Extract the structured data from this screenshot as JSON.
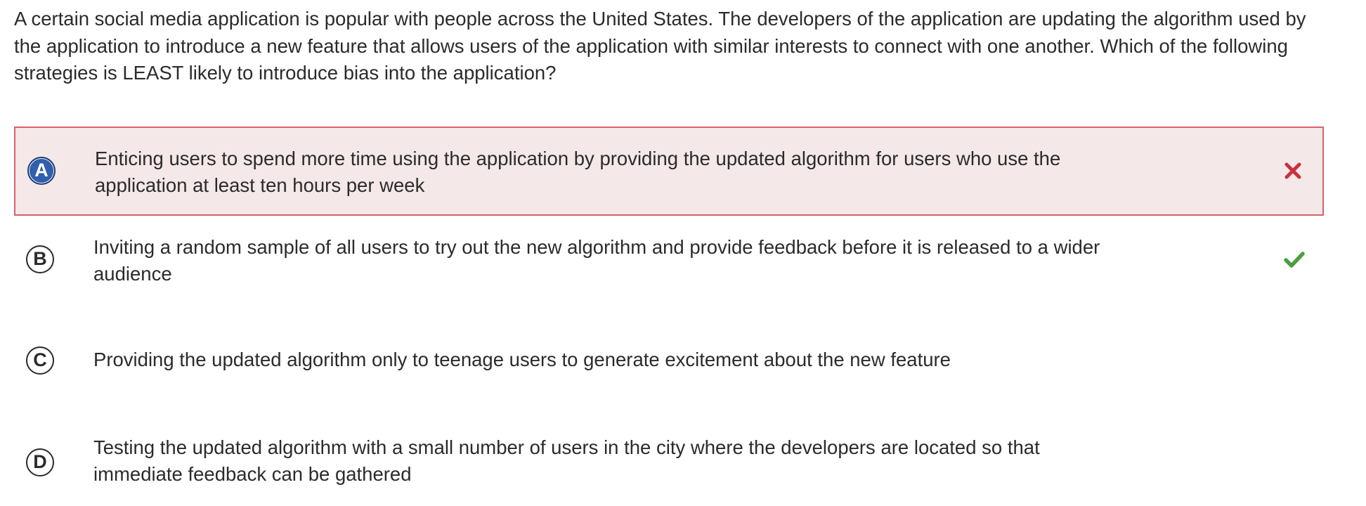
{
  "question": {
    "text": "A certain social media application is popular with people across the United States. The developers of the application are updating the algorithm used by the application to introduce a new feature that allows users of the application with similar interests to connect with one another. Which of the following strategies is LEAST likely to introduce bias into the application?"
  },
  "options": [
    {
      "letter": "A",
      "text": "Enticing users to spend more time using the application by providing the updated algorithm for users who use the application at least ten hours per week",
      "state": "selected-incorrect",
      "mark_icon": "x-icon",
      "mark_color": "#c8313d"
    },
    {
      "letter": "B",
      "text": "Inviting a random sample of all users to try out the new algorithm and provide feedback before it is released to a wider audience",
      "state": "correct",
      "mark_icon": "check-icon",
      "mark_color": "#4a9e3f"
    },
    {
      "letter": "C",
      "text": "Providing the updated algorithm only to teenage users to generate excitement about the new feature",
      "state": "unselected"
    },
    {
      "letter": "D",
      "text": "Testing the updated algorithm with a small number of users in the city where the developers are located so that immediate feedback can be gathered",
      "state": "unselected"
    }
  ],
  "colors": {
    "selected_background": "#f5e8e9",
    "selected_border": "#d9606a",
    "selected_letter_fill": "#2f5fad"
  }
}
